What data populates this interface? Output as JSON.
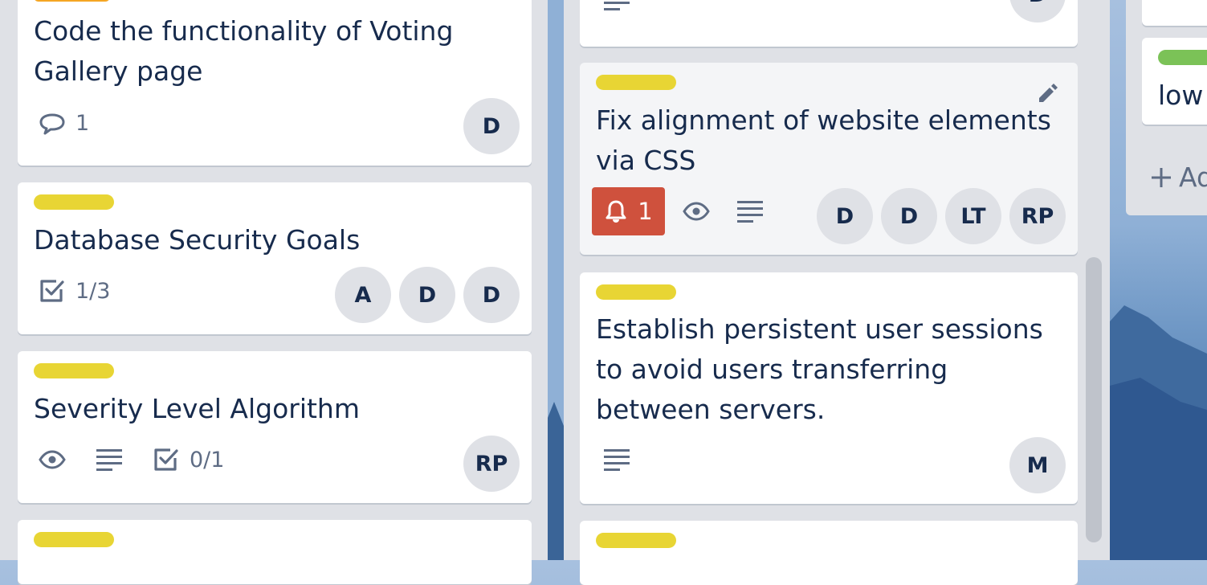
{
  "colors": {
    "label_yellow": "#e8d534",
    "label_orange": "#f5a623",
    "label_green": "#7bc257",
    "notification_red": "#cf513d",
    "list_bg": "#dfe1e6",
    "avatar_bg": "#dfe1e6",
    "text": "#172b4d",
    "muted": "#5e6c84"
  },
  "list1": {
    "cards": [
      {
        "title": "Code the functionality of Voting Gallery page",
        "comments": "1",
        "members": [
          "D"
        ]
      },
      {
        "title": "Database Security Goals",
        "checklist": "1/3",
        "members": [
          "A",
          "D",
          "D"
        ]
      },
      {
        "title": "Severity Level Algorithm",
        "checklist": "0/1",
        "members": [
          "RP"
        ]
      }
    ]
  },
  "list2": {
    "cards": [
      {
        "members": [
          "D"
        ]
      },
      {
        "title": "Fix alignment of website elements via CSS",
        "notifications": "1",
        "members": [
          "D",
          "D",
          "LT",
          "RP"
        ]
      },
      {
        "title": "Establish persistent user sessions to avoid users transferring between servers.",
        "members": [
          "M"
        ]
      }
    ]
  },
  "list3": {
    "cards": [
      {
        "title": "low"
      }
    ],
    "add_card": "Ad"
  },
  "icons": {
    "comment": "comment-icon",
    "checklist": "checklist-icon",
    "watch": "eye-icon",
    "description": "description-icon",
    "bell": "bell-icon",
    "edit": "pencil-icon",
    "plus": "plus-icon"
  }
}
